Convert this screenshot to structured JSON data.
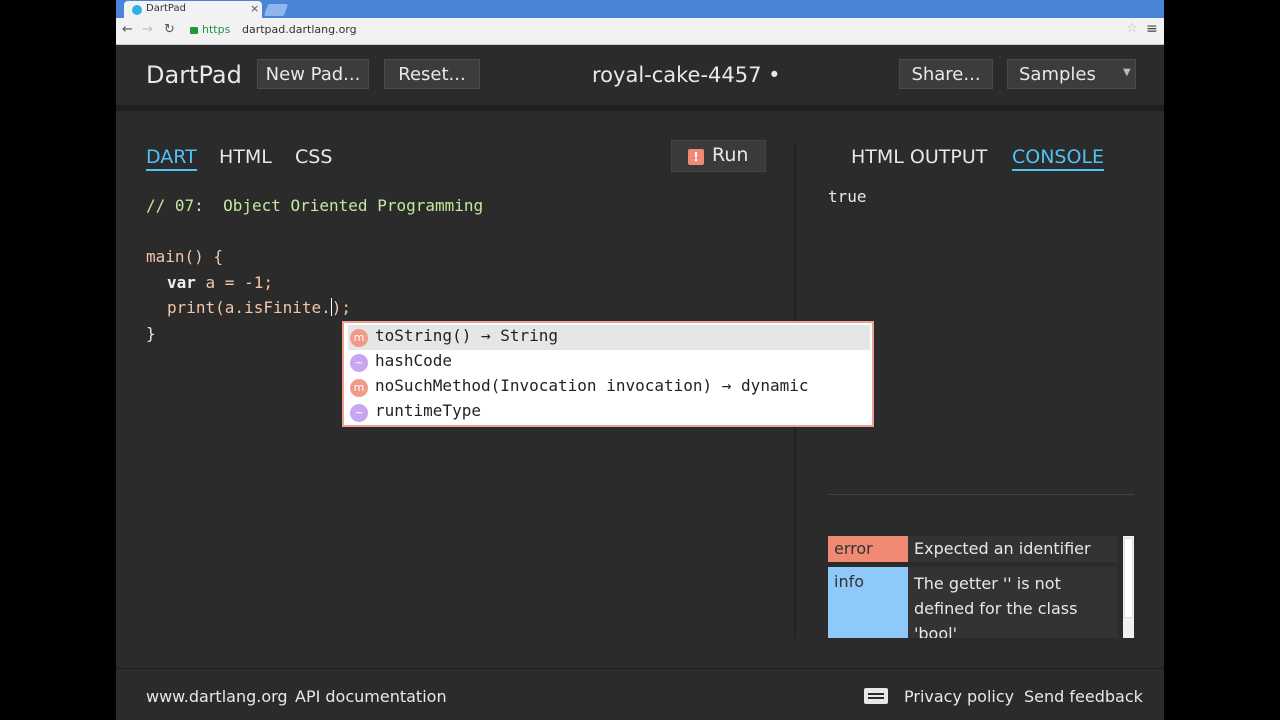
{
  "browser": {
    "tab_title": "DartPad",
    "tab_close": "×",
    "protocol": "https",
    "url": "dartpad.dartlang.org",
    "back": "←",
    "forward": "→",
    "reload": "↻",
    "menu": "≡",
    "star": "☆"
  },
  "header": {
    "brand": "DartPad",
    "new_pad": "New Pad...",
    "reset": "Reset...",
    "pad_name": "royal-cake-4457 •",
    "share": "Share...",
    "samples": "Samples",
    "samples_caret": "▼"
  },
  "editor": {
    "tabs": [
      {
        "label": "DART",
        "active": true
      },
      {
        "label": "HTML",
        "active": false
      },
      {
        "label": "CSS",
        "active": false
      }
    ],
    "run_icon": "!",
    "run_label": "Run",
    "code": {
      "comment": "// 07:  Object Oriented Programming",
      "line_main": "main() {",
      "line_var_kw": "var",
      "line_var_rest": " a = -1;",
      "line_print_before": "print(a.isFinite.",
      "line_print_after": ");",
      "line_close": "}"
    }
  },
  "autocomplete": {
    "items": [
      {
        "kind": "m",
        "text": "toString() → String",
        "selected": true
      },
      {
        "kind": "~",
        "text": "hashCode",
        "selected": false
      },
      {
        "kind": "m",
        "text": "noSuchMethod(Invocation invocation) → dynamic",
        "selected": false
      },
      {
        "kind": "~",
        "text": "runtimeType",
        "selected": false
      }
    ]
  },
  "output": {
    "tabs": [
      {
        "label": "HTML OUTPUT",
        "active": false
      },
      {
        "label": "CONSOLE",
        "active": true
      }
    ],
    "console_text": "true",
    "issues": [
      {
        "kind": "error",
        "message": "Expected an identifier",
        "color": "#f08a74"
      },
      {
        "kind": "info",
        "message": "The getter '' is not defined for the class 'bool'",
        "color": "#8ec9f9"
      }
    ]
  },
  "footer": {
    "links_left": [
      "www.dartlang.org",
      "API documentation"
    ],
    "privacy": "Privacy policy",
    "feedback": "Send feedback"
  },
  "colors": {
    "accent": "#4fc3f7",
    "background": "#2b2b2b",
    "error": "#f08a74",
    "info": "#8ec9f9"
  }
}
